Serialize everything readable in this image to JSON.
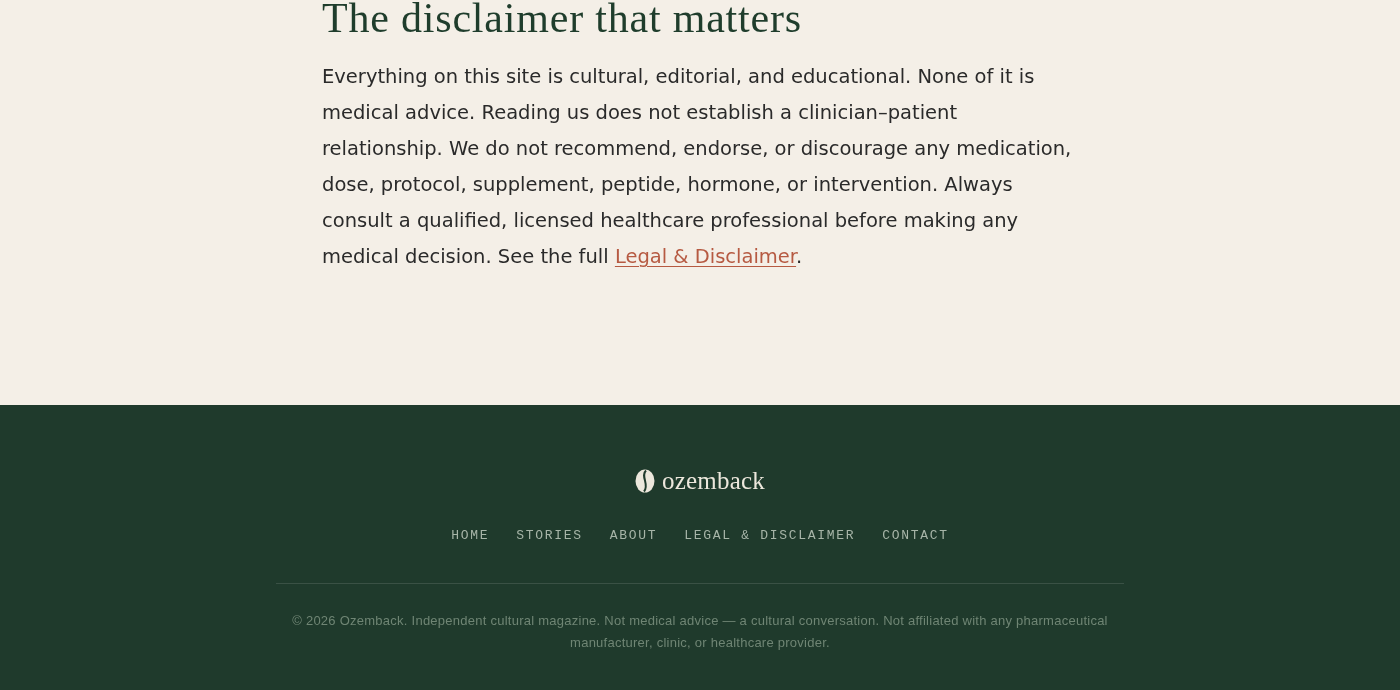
{
  "article": {
    "heading": "The disclaimer that matters",
    "paragraph": {
      "text": "Everything on this site is cultural, editorial, and educational. None of it is medical advice. Reading us does not establish a clinician–patient relationship. We do not recommend, endorse, or discourage any medication, dose, protocol, supplement, peptide, hormone, or intervention. Always consult a qualified, licensed healthcare professional before making any medical decision. See the full ",
      "link": "Legal & Disclaimer",
      "end": "."
    }
  },
  "footer": {
    "brand": "ozemback",
    "nav": [
      {
        "label": "HOME"
      },
      {
        "label": "STORIES"
      },
      {
        "label": "ABOUT"
      },
      {
        "label": "LEGAL & DISCLAIMER"
      },
      {
        "label": "CONTACT"
      }
    ],
    "copyright": "© 2026 Ozemback. Independent cultural magazine. Not medical advice — a cultural conversation. Not affiliated with any pharmaceutical manufacturer, clinic, or healthcare provider."
  }
}
